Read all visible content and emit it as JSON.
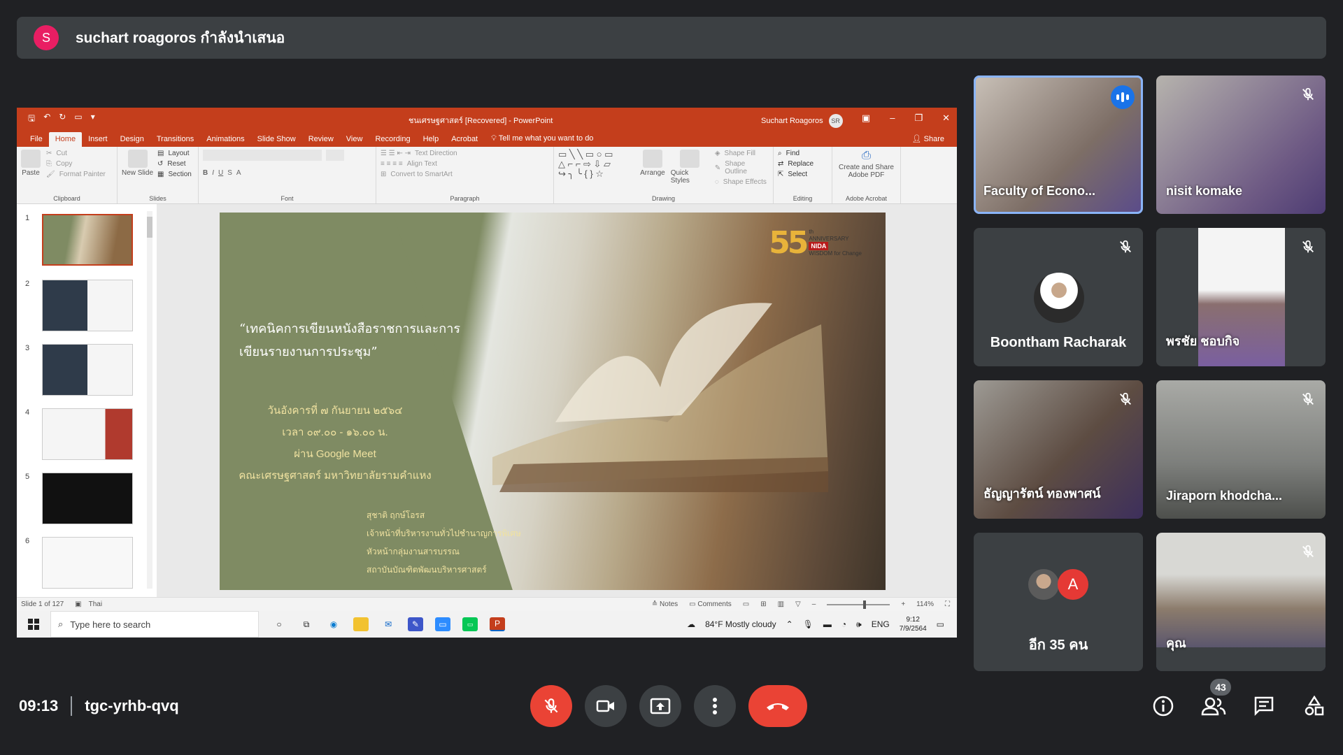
{
  "presenter": {
    "initial": "S",
    "text": "suchart roagoros กำลังนำเสนอ",
    "avatar_color": "#e91e63"
  },
  "powerpoint": {
    "doc_title": "ชนเศรษฐศาสตร์ [Recovered] - PowerPoint",
    "user_name": "Suchart Roagoros",
    "user_initials": "SR",
    "tabs": [
      "File",
      "Home",
      "Insert",
      "Design",
      "Transitions",
      "Animations",
      "Slide Show",
      "Review",
      "View",
      "Recording",
      "Help",
      "Acrobat"
    ],
    "active_tab": "Home",
    "tell_me": "Tell me what you want to do",
    "share": "Share",
    "ribbon": {
      "clipboard": {
        "label": "Clipboard",
        "paste": "Paste",
        "cut": "Cut",
        "copy": "Copy",
        "format_painter": "Format Painter"
      },
      "slides": {
        "label": "Slides",
        "new_slide": "New Slide",
        "layout": "Layout",
        "reset": "Reset",
        "section": "Section"
      },
      "font": {
        "label": "Font"
      },
      "paragraph": {
        "label": "Paragraph",
        "text_direction": "Text Direction",
        "align_text": "Align Text",
        "convert_smartart": "Convert to SmartArt"
      },
      "drawing": {
        "label": "Drawing",
        "arrange": "Arrange",
        "quick_styles": "Quick Styles",
        "shape_fill": "Shape Fill",
        "shape_outline": "Shape Outline",
        "shape_effects": "Shape Effects"
      },
      "editing": {
        "label": "Editing",
        "find": "Find",
        "replace": "Replace",
        "select": "Select"
      },
      "adobe": {
        "label": "Adobe Acrobat",
        "create_share": "Create and Share Adobe PDF"
      }
    },
    "thumbnail_numbers": [
      "1",
      "2",
      "3",
      "4",
      "5",
      "6"
    ],
    "slide": {
      "title": "“เทคนิคการเขียนหนังสือราชการและการเขียนรายงานการประชุม”",
      "info": [
        "วันอังคารที่ ๗ กันยายน ๒๕๖๔",
        "เวลา ๐๙.๐๐ - ๑๖.๐๐ น.",
        "ผ่าน Google Meet",
        "คณะเศรษฐศาสตร์ มหาวิทยาลัยรามคำแหง"
      ],
      "author": [
        "สุชาติ ฤกษ์โอรส",
        "เจ้าหน้าที่บริหารงานทั่วไปชำนาญการพิเศษ",
        "หัวหน้ากลุ่มงานสารบรรณ",
        "สถาบันบัณฑิตพัฒนบริหารศาสตร์"
      ],
      "logo_number": "55",
      "logo_sup": "th",
      "logo_anniversary": "ANNIVERSARY",
      "logo_nida": "NIDA",
      "logo_tagline": "WISDOM for Change"
    },
    "status": {
      "slide_of": "Slide 1 of 127",
      "language": "Thai",
      "notes": "Notes",
      "comments": "Comments",
      "zoom": "114%"
    }
  },
  "taskbar": {
    "search_placeholder": "Type here to search",
    "weather": "84°F  Mostly cloudy",
    "lang": "ENG",
    "time": "9:12",
    "date": "7/9/2564"
  },
  "participants": [
    {
      "name": "Faculty of Econo...",
      "speaking": true
    },
    {
      "name": "nisit komake",
      "muted": true
    },
    {
      "name": "Boontham Racharak",
      "muted": true
    },
    {
      "name": "พรชัย ชอบกิจ",
      "muted": true
    },
    {
      "name": "ธัญญารัตน์ ทองพาศน์",
      "muted": true
    },
    {
      "name": "Jiraporn khodcha...",
      "muted": true
    },
    {
      "name": "อีก 35 คน",
      "avatar_letter": "A"
    },
    {
      "name": "คุณ",
      "muted": true
    }
  ],
  "meeting": {
    "time": "09:13",
    "code": "tgc-yrhb-qvq",
    "participant_count": "43"
  },
  "colors": {
    "ppt_red": "#c43e1c",
    "meet_bg": "#202124",
    "end_call": "#ea4335",
    "accent": "#8ab4f8"
  }
}
